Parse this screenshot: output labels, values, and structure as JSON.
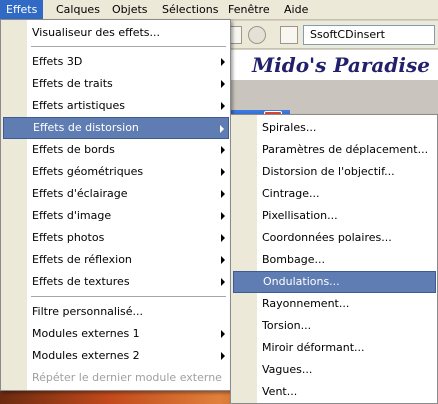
{
  "menubar": {
    "items": [
      {
        "label": "Effets",
        "active": true
      },
      {
        "label": "Calques"
      },
      {
        "label": "Objets"
      },
      {
        "label": "Sélections"
      },
      {
        "label": "Fenêtre"
      },
      {
        "label": "Aide"
      }
    ]
  },
  "toolbar": {
    "preset_value": "SsoftCDinsert"
  },
  "banner": {
    "text": "Mido's Paradise"
  },
  "effects_menu": {
    "items": [
      {
        "label": "Visualiseur des effets..."
      },
      {
        "label": "Effets 3D",
        "submenu": true
      },
      {
        "label": "Effets de traits",
        "submenu": true
      },
      {
        "label": "Effets artistiques",
        "submenu": true
      },
      {
        "label": "Effets de distorsion",
        "submenu": true,
        "highlighted": true
      },
      {
        "label": "Effets de bords",
        "submenu": true
      },
      {
        "label": "Effets géométriques",
        "submenu": true
      },
      {
        "label": "Effets d'éclairage",
        "submenu": true
      },
      {
        "label": "Effets d'image",
        "submenu": true
      },
      {
        "label": "Effets photos",
        "submenu": true
      },
      {
        "label": "Effets de réflexion",
        "submenu": true
      },
      {
        "label": "Effets de textures",
        "submenu": true
      },
      {
        "label": "Filtre personnalisé..."
      },
      {
        "label": "Modules externes 1",
        "submenu": true
      },
      {
        "label": "Modules externes 2",
        "submenu": true
      },
      {
        "label": "Répéter le dernier module externe",
        "disabled": true
      }
    ]
  },
  "distortion_submenu": {
    "items": [
      {
        "label": "Spirales..."
      },
      {
        "label": "Paramètres de déplacement..."
      },
      {
        "label": "Distorsion de l'objectif..."
      },
      {
        "label": "Cintrage..."
      },
      {
        "label": "Pixellisation..."
      },
      {
        "label": "Coordonnées polaires..."
      },
      {
        "label": "Bombage..."
      },
      {
        "label": "Ondulations...",
        "highlighted": true
      },
      {
        "label": "Rayonnement..."
      },
      {
        "label": "Torsion..."
      },
      {
        "label": "Miroir déformant..."
      },
      {
        "label": "Vagues..."
      },
      {
        "label": "Vent..."
      }
    ]
  },
  "colors": {
    "highlight": "#5f7db3",
    "menubar_active": "#316ac5",
    "banner_text": "#23206b"
  }
}
